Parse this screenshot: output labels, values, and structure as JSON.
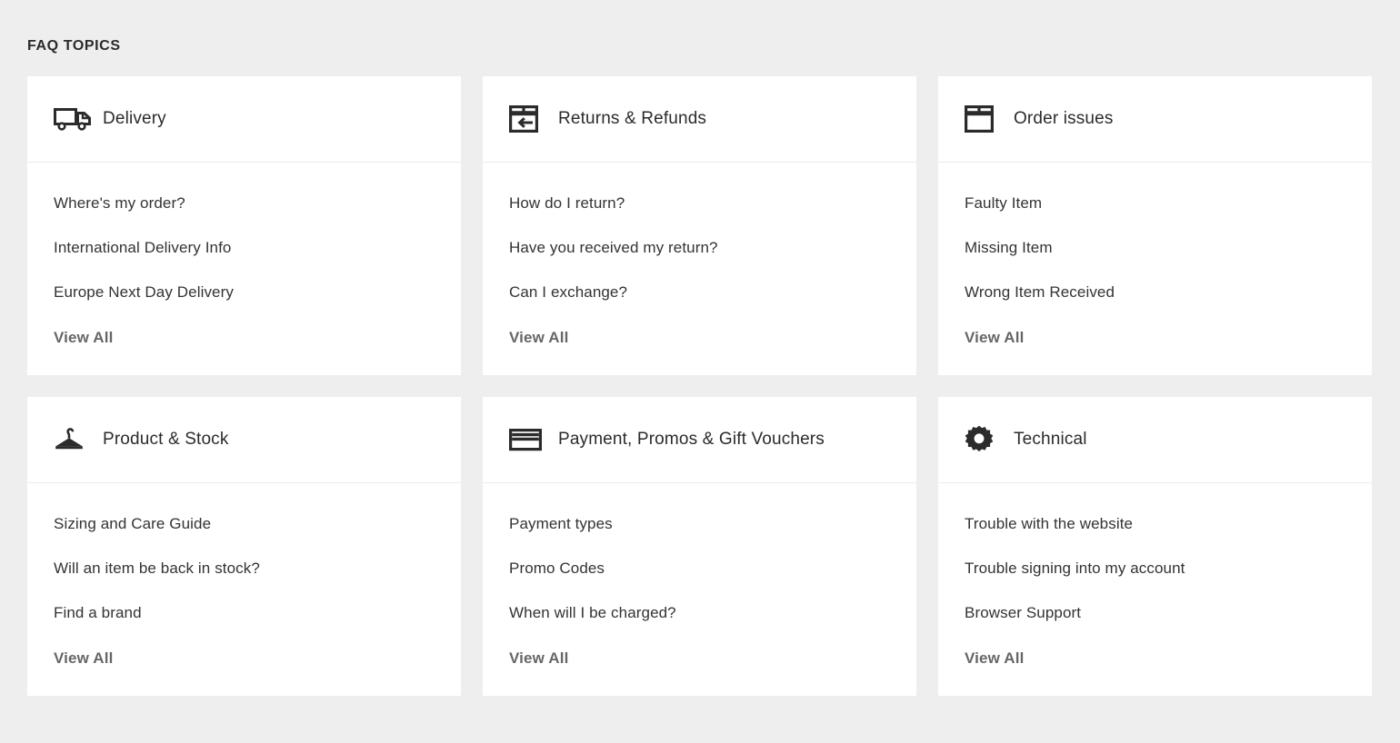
{
  "section": {
    "heading": "FAQ TOPICS"
  },
  "colors": {
    "page_background": "#eeeeee",
    "card_background": "#ffffff",
    "divider": "#ebebeb",
    "title_text": "#2b2b2b",
    "link_text": "#333333",
    "view_all_text": "#666666"
  },
  "cards": [
    {
      "icon": "delivery-truck-icon",
      "title": "Delivery",
      "links": [
        "Where's my order?",
        "International Delivery Info",
        "Europe Next Day Delivery"
      ],
      "view_all_label": "View All"
    },
    {
      "icon": "return-box-icon",
      "title": "Returns & Refunds",
      "links": [
        "How do I return?",
        "Have you received my return?",
        "Can I exchange?"
      ],
      "view_all_label": "View All"
    },
    {
      "icon": "package-box-icon",
      "title": "Order issues",
      "links": [
        "Faulty Item",
        "Missing Item",
        "Wrong Item Received"
      ],
      "view_all_label": "View All"
    },
    {
      "icon": "clothes-hanger-icon",
      "title": "Product & Stock",
      "links": [
        "Sizing and Care Guide",
        "Will an item be back in stock?",
        "Find a brand"
      ],
      "view_all_label": "View All"
    },
    {
      "icon": "credit-card-icon",
      "title": "Payment, Promos & Gift Vouchers",
      "links": [
        "Payment types",
        "Promo Codes",
        "When will I be charged?"
      ],
      "view_all_label": "View All"
    },
    {
      "icon": "gear-icon",
      "title": "Technical",
      "links": [
        "Trouble with the website",
        "Trouble signing into my account",
        "Browser Support"
      ],
      "view_all_label": "View All"
    }
  ]
}
